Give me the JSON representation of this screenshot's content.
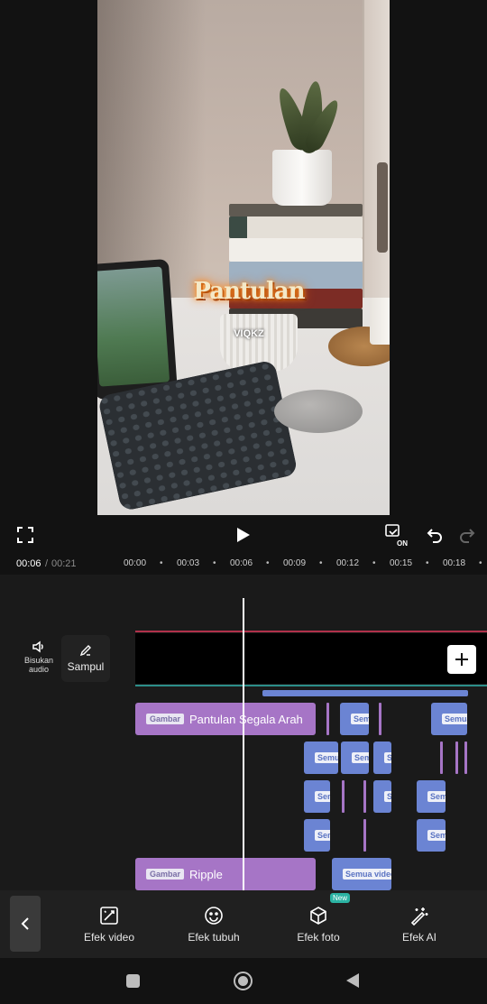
{
  "preview": {
    "sticker_title": "Pantulan",
    "sticker_author": "VIQKZ"
  },
  "controls": {
    "fullscreen_icon": "fullscreen-icon",
    "play_icon": "play-icon",
    "keyframe_badge": "ON",
    "undo_icon": "undo-icon",
    "redo_icon": "redo-icon"
  },
  "time": {
    "current": "00:06",
    "separator": "/",
    "total": "00:21",
    "ticks": [
      "00:00",
      "00:03",
      "00:06",
      "00:09",
      "00:12",
      "00:15",
      "00:18"
    ]
  },
  "timeline": {
    "mute_label": "Bisukan audio",
    "cover_label": "Sampul",
    "add_icon": "plus-icon",
    "clip_tag": "Gambar",
    "clip1_label": "Pantulan Segala Arah",
    "clip2_label": "Ripple",
    "small_tag": "Semua",
    "small_tag_full": "Semua video"
  },
  "toolbar": {
    "back_icon": "chevron-left-icon",
    "items": [
      {
        "label": "Efek video",
        "icon": "video-effect-icon"
      },
      {
        "label": "Efek tubuh",
        "icon": "face-icon"
      },
      {
        "label": "Efek foto",
        "icon": "cube-icon",
        "badge": "New"
      },
      {
        "label": "Efek AI",
        "icon": "magic-wand-icon"
      }
    ]
  },
  "colors": {
    "clip_purple": "#a675c6",
    "clip_blue": "#6b84d3",
    "badge_teal": "#2bb3a3",
    "playhead": "#ffffff"
  }
}
